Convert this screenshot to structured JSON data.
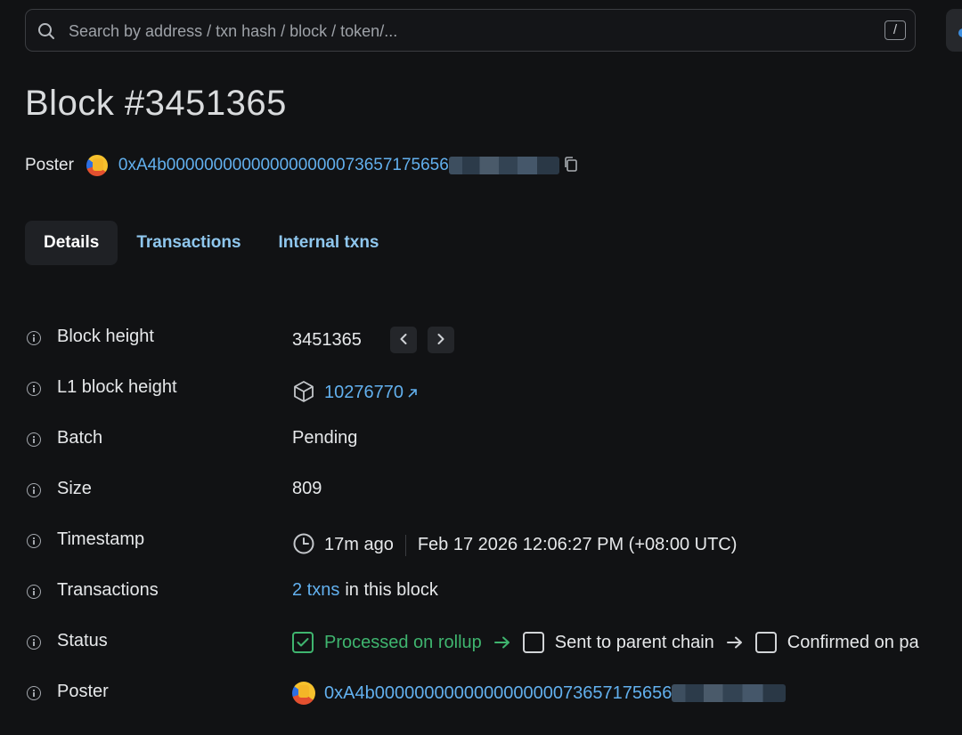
{
  "search": {
    "placeholder": "Search by address / txn hash / block / token/...",
    "shortcut": "/"
  },
  "header": {
    "title": "Block #3451365",
    "poster_label": "Poster",
    "poster_address": "0xA4b000000000000000000073657175656"
  },
  "tabs": [
    {
      "label": "Details"
    },
    {
      "label": "Transactions"
    },
    {
      "label": "Internal txns"
    }
  ],
  "details": {
    "block_height": {
      "label": "Block height",
      "value": "3451365"
    },
    "l1_block_height": {
      "label": "L1 block height",
      "value": "10276770"
    },
    "batch": {
      "label": "Batch",
      "value": "Pending"
    },
    "size": {
      "label": "Size",
      "value": "809"
    },
    "timestamp": {
      "label": "Timestamp",
      "relative": "17m ago",
      "absolute": "Feb 17 2026 12:06:27 PM (+08:00 UTC)"
    },
    "transactions": {
      "label": "Transactions",
      "link": "2 txns",
      "suffix": "in this block"
    },
    "status": {
      "label": "Status",
      "steps": [
        "Processed on rollup",
        "Sent to parent chain",
        "Confirmed on pa"
      ]
    },
    "poster": {
      "label": "Poster",
      "value": "0xA4b000000000000000000073657175656"
    }
  },
  "icons": [
    "search-icon",
    "copy-icon",
    "chevron-left-icon",
    "chevron-right-icon",
    "cube-icon",
    "external-link-icon",
    "clock-icon",
    "check-icon",
    "arrow-right-icon",
    "info-icon"
  ],
  "colors": {
    "link": "#62b0ee",
    "success": "#3fb56f",
    "background": "#111214"
  }
}
